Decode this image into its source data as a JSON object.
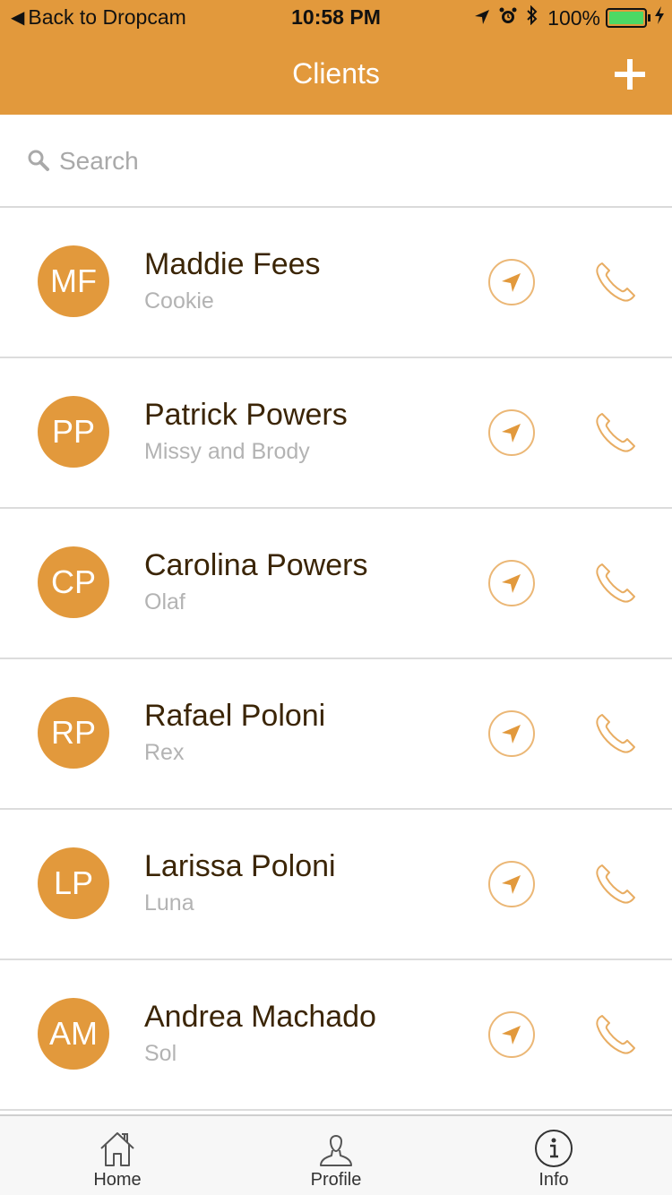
{
  "status_bar": {
    "back_label": "Back to Dropcam",
    "time": "10:58 PM",
    "battery": "100%"
  },
  "header": {
    "title": "Clients"
  },
  "search": {
    "placeholder": "Search"
  },
  "clients": [
    {
      "initials": "MF",
      "name": "Maddie Fees",
      "pet": "Cookie"
    },
    {
      "initials": "PP",
      "name": "Patrick Powers",
      "pet": "Missy and Brody"
    },
    {
      "initials": "CP",
      "name": "Carolina Powers",
      "pet": "Olaf"
    },
    {
      "initials": "RP",
      "name": "Rafael Poloni",
      "pet": "Rex"
    },
    {
      "initials": "LP",
      "name": "Larissa Poloni",
      "pet": "Luna"
    },
    {
      "initials": "AM",
      "name": "Andrea Machado",
      "pet": "Sol"
    }
  ],
  "tabbar": {
    "tabs": [
      {
        "label": "Home",
        "icon": "home-icon"
      },
      {
        "label": "Profile",
        "icon": "profile-icon"
      },
      {
        "label": "Info",
        "icon": "info-icon"
      }
    ]
  },
  "colors": {
    "accent": "#E2993C",
    "battery_fill": "#4CD964",
    "name_text": "#3b2506",
    "secondary_text": "#b3b3b3"
  }
}
